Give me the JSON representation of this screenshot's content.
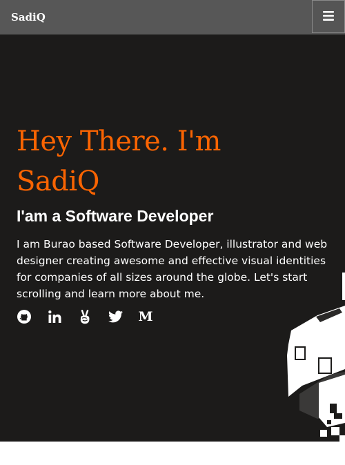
{
  "navbar": {
    "brand": "SadiQ",
    "menu_icon": "hamburger-menu-icon"
  },
  "hero": {
    "headline_line1": "Hey There. I'm",
    "headline_line2": "SadiQ",
    "subheadline": "I'am a Software Developer",
    "bio": "I am Burao based Software Developer, illustrator and web designer creating awesome and effective visual identities for companies of all sizes around the globe. Let's start scrolling and learn more about me.",
    "socials": [
      "github-icon",
      "linkedin-icon",
      "angellist-icon",
      "twitter-icon",
      "medium-icon"
    ],
    "medium_glyph": "M"
  },
  "colors": {
    "accent": "#fa6402",
    "hero_background": "#1c1b1a",
    "navbar_background": "#575757",
    "text": "#ffffff"
  }
}
